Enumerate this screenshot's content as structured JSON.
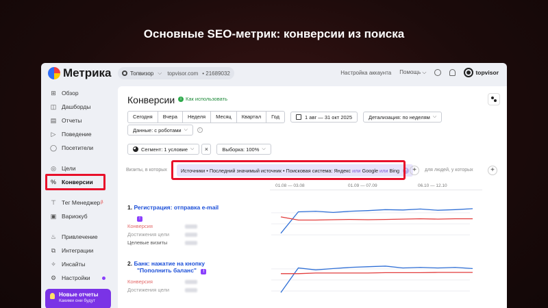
{
  "slide": {
    "title": "Основные SEO-метрик: конверсии из поиска"
  },
  "brand": {
    "app_name": "Метрика",
    "partner": "topvisor"
  },
  "topbar": {
    "site_name": "Топвизор",
    "site_url": "topvisor.com",
    "counter_id": "21689032",
    "account_settings": "Настройка аккаунта",
    "help": "Помощь"
  },
  "sidebar": {
    "items": [
      {
        "label": "Обзор",
        "icon": "grid-icon"
      },
      {
        "label": "Дашборды",
        "icon": "dashboard-icon"
      },
      {
        "label": "Отчеты",
        "icon": "reports-icon"
      },
      {
        "label": "Поведение",
        "icon": "play-icon"
      },
      {
        "label": "Посетители",
        "icon": "user-icon"
      },
      {
        "label": "Цели",
        "icon": "target-icon"
      },
      {
        "label": "Конверсии",
        "icon": "percent-icon"
      },
      {
        "label": "Тег Менеджер",
        "icon": "tag-icon",
        "badge": "β"
      },
      {
        "label": "Вариокуб",
        "icon": "cube-icon"
      },
      {
        "label": "Привлечение",
        "icon": "flame-icon"
      },
      {
        "label": "Интеграции",
        "icon": "puzzle-icon"
      },
      {
        "label": "Инсайты",
        "icon": "sparkle-icon"
      },
      {
        "label": "Настройки",
        "icon": "gear-icon"
      }
    ],
    "promo_title": "Новые отчеты",
    "promo_sub": "Какими они будут"
  },
  "page": {
    "title": "Конверсии",
    "how_to": "Как использовать",
    "periods": [
      "Сегодня",
      "Вчера",
      "Неделя",
      "Месяц",
      "Квартал",
      "Год"
    ],
    "date_range": "1 авг — 31 окт 2025",
    "detail": "Детализация: по неделям",
    "data_source": "Данные: с роботами",
    "segment": "Сегмент: 1 условие",
    "sample": "Выборка: 100%",
    "visits_label": "Визиты, в которых",
    "filter_parts": [
      "Источники",
      "Последний значимый источник",
      "Поисковая система: Яндекс"
    ],
    "filter_or": "или",
    "filter_google": "Google",
    "filter_bing": "Bing",
    "people_label": "для людей, у которых",
    "timeline": [
      "01.08 — 03.08",
      "01.09 — 07.09",
      "06.10 — 12.10"
    ]
  },
  "goals": [
    {
      "num": "1.",
      "title": "Регистрация: отправка e-mail",
      "title2": "",
      "metrics": [
        "Конверсия",
        "Достижения цели",
        "Целевые визиты"
      ]
    },
    {
      "num": "2.",
      "title": "Банк: нажатие на кнопку",
      "title2": "\"Пополнить баланс\"",
      "metrics": [
        "Конверсия",
        "Достижения цели"
      ]
    }
  ],
  "colors": {
    "accent": "#8a3ffc",
    "highlight": "#e8102a",
    "series_blue": "#2f6fd6",
    "series_red": "#e23b3b"
  },
  "chart_data": [
    {
      "type": "line",
      "title": "",
      "series": [
        {
          "values": [
            0.2,
            0.88,
            0.9,
            0.86,
            0.9,
            0.92,
            0.95,
            0.94,
            0.97,
            0.93,
            0.95,
            0.98
          ]
        },
        {
          "values": [
            0.72,
            0.62,
            0.62,
            0.63,
            0.64,
            0.63,
            0.64,
            0.65,
            0.66,
            0.65,
            0.66,
            0.66
          ]
        }
      ]
    },
    {
      "type": "line",
      "title": "",
      "series": [
        {
          "values": [
            0.1,
            0.88,
            0.82,
            0.86,
            0.9,
            0.92,
            0.94,
            0.88,
            0.9,
            0.88,
            0.9,
            0.86
          ]
        },
        {
          "values": [
            0.7,
            0.7,
            0.72,
            0.72,
            0.72,
            0.72,
            0.73,
            0.73,
            0.73,
            0.74,
            0.74,
            0.74
          ]
        }
      ]
    }
  ]
}
